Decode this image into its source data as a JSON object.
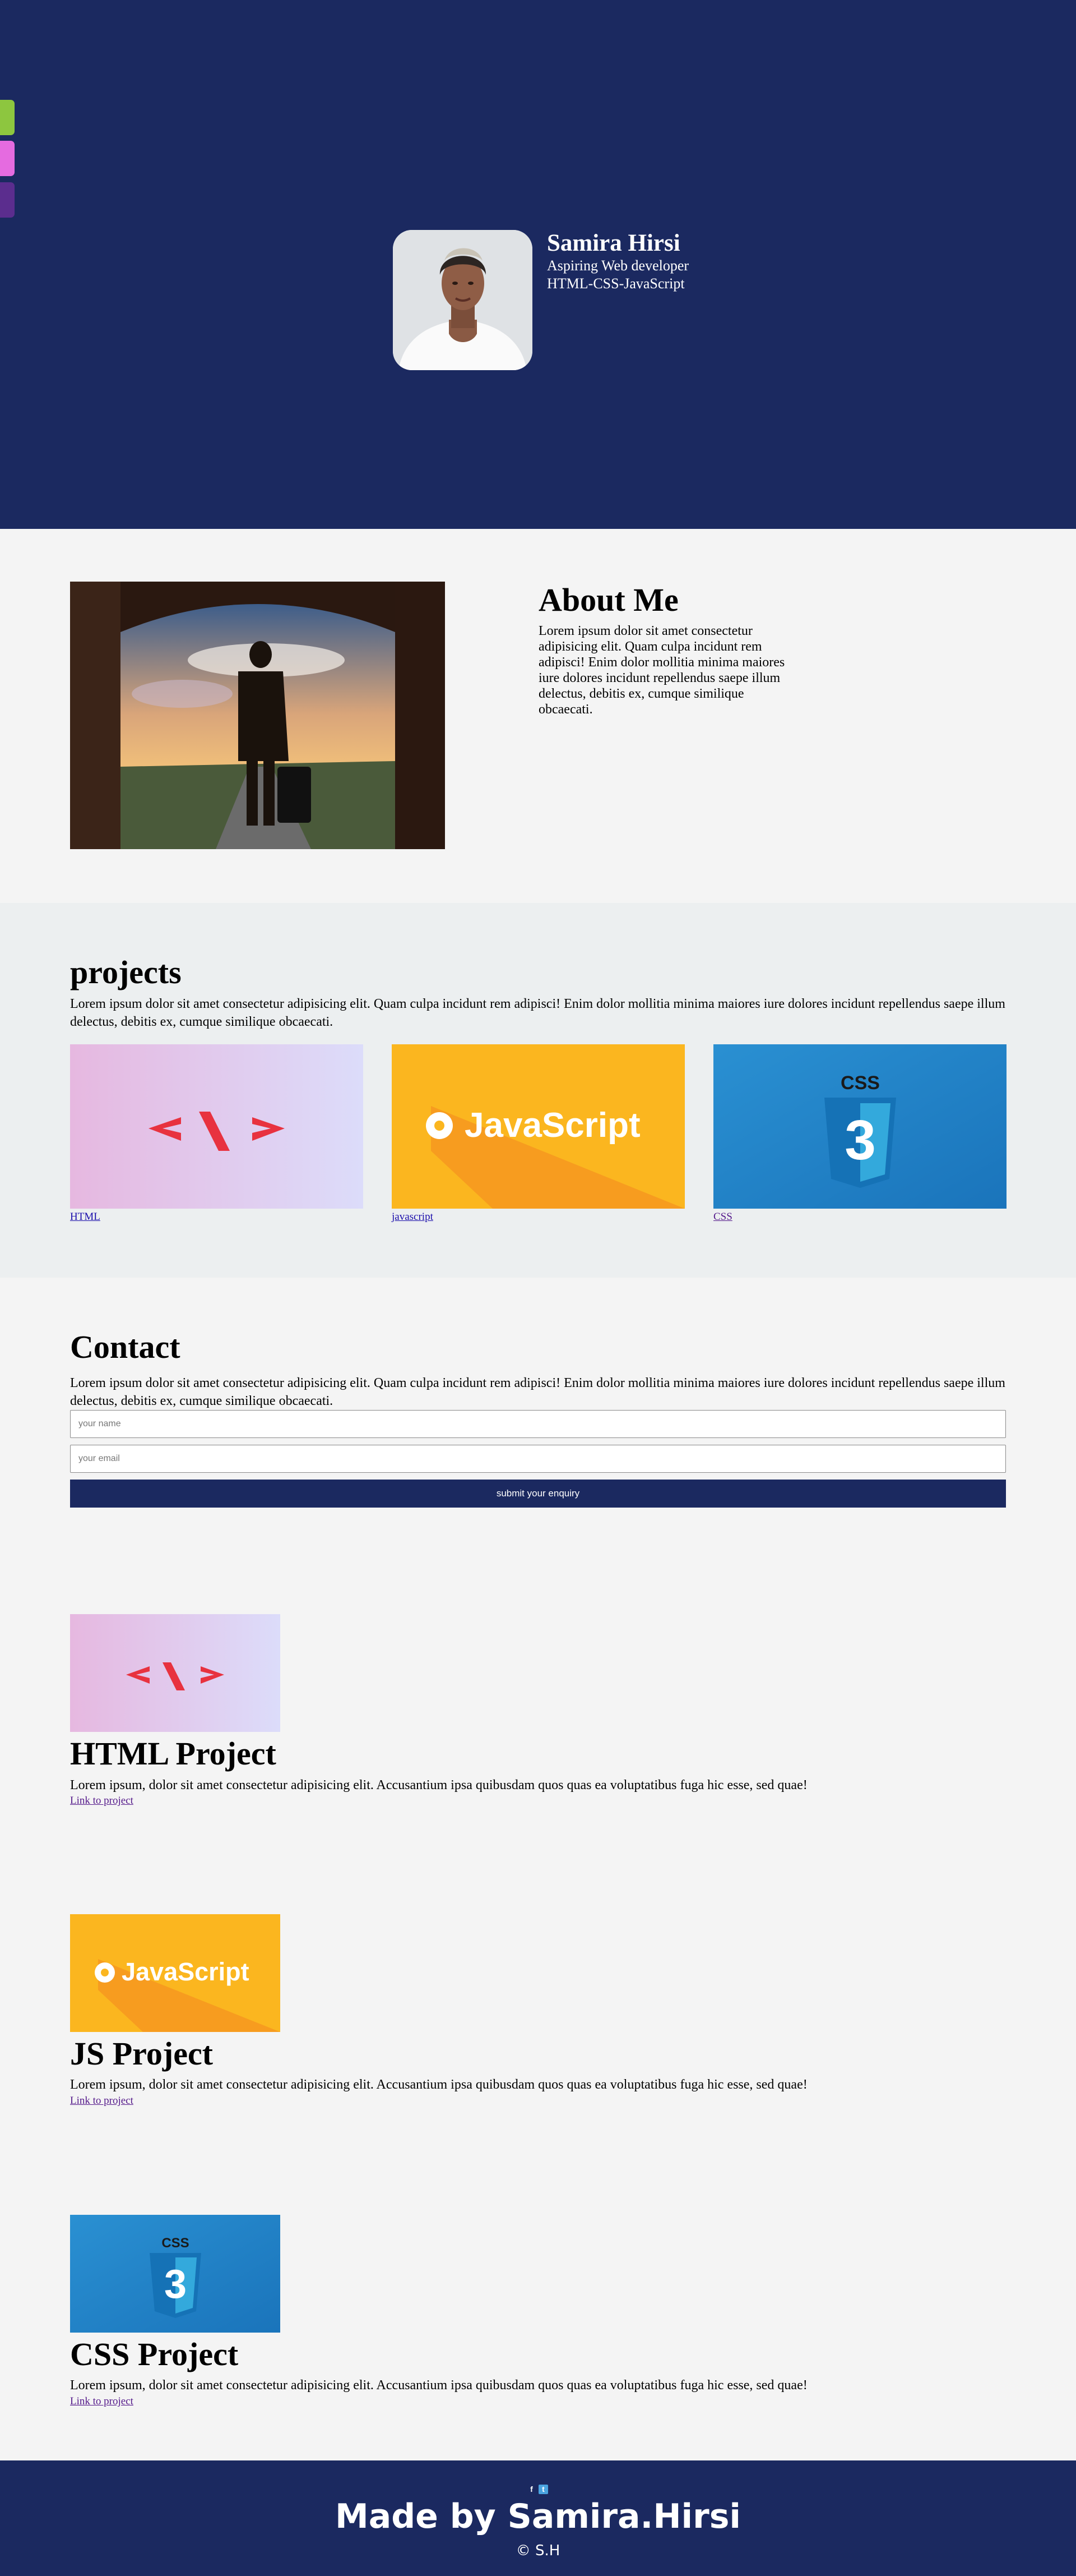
{
  "colors": {
    "hero_bg": "#1b2960",
    "accent_green": "#8dc63f",
    "accent_pink": "#e56be0",
    "accent_purple": "#5b2d8e",
    "footer_bg": "#1b2960",
    "button_bg": "#1b2960"
  },
  "hero": {
    "name": "Samira Hirsi",
    "role": "Aspiring Web developer",
    "skills": "HTML-CSS-JavaScript"
  },
  "about": {
    "title": "About Me",
    "text": "Lorem ipsum dolor sit amet consectetur adipisicing elit. Quam culpa incidunt rem adipisci! Enim dolor mollitia minima maiores iure dolores incidunt repellendus saepe illum delectus, debitis ex, cumque similique obcaecati."
  },
  "projects": {
    "title": "projects",
    "text": "Lorem ipsum dolor sit amet consectetur adipisicing elit. Quam culpa incidunt rem adipisci! Enim dolor mollitia minima maiores iure dolores incidunt repellendus saepe illum delectus, debitis ex, cumque similique obcaecati.",
    "cards": [
      {
        "label": "HTML",
        "image": "html-code-image"
      },
      {
        "label": "javascript",
        "image": "javascript-logo-image"
      },
      {
        "label": "CSS",
        "image": "css3-logo-image"
      }
    ]
  },
  "contact": {
    "title": "Contact",
    "text": "Lorem ipsum dolor sit amet consectetur adipisicing elit. Quam culpa incidunt rem adipisci! Enim dolor mollitia minima maiores iure dolores incidunt repellendus saepe illum delectus, debitis ex, cumque similique obcaecati.",
    "name_placeholder": "your name",
    "email_placeholder": "your email",
    "submit_label": "submit your enquiry"
  },
  "details": [
    {
      "title": "HTML Project",
      "text": "Lorem ipsum, dolor sit amet consectetur adipisicing elit. Accusantium ipsa quibusdam quos quas ea voluptatibus fuga hic esse, sed quae!",
      "link": "Link to project"
    },
    {
      "title": "JS Project",
      "text": "Lorem ipsum, dolor sit amet consectetur adipisicing elit. Accusantium ipsa quibusdam quos quas ea voluptatibus fuga hic esse, sed quae!",
      "link": "Link to project"
    },
    {
      "title": "CSS Project",
      "text": "Lorem ipsum, dolor sit amet consectetur adipisicing elit. Accusantium ipsa quibusdam quos quas ea voluptatibus fuga hic esse, sed quae!",
      "link": "Link to project"
    }
  ],
  "footer": {
    "facebook_glyph": "f",
    "twitter_glyph": "t",
    "title": "Made by Samira.Hirsi",
    "copyright": "© S.H"
  }
}
